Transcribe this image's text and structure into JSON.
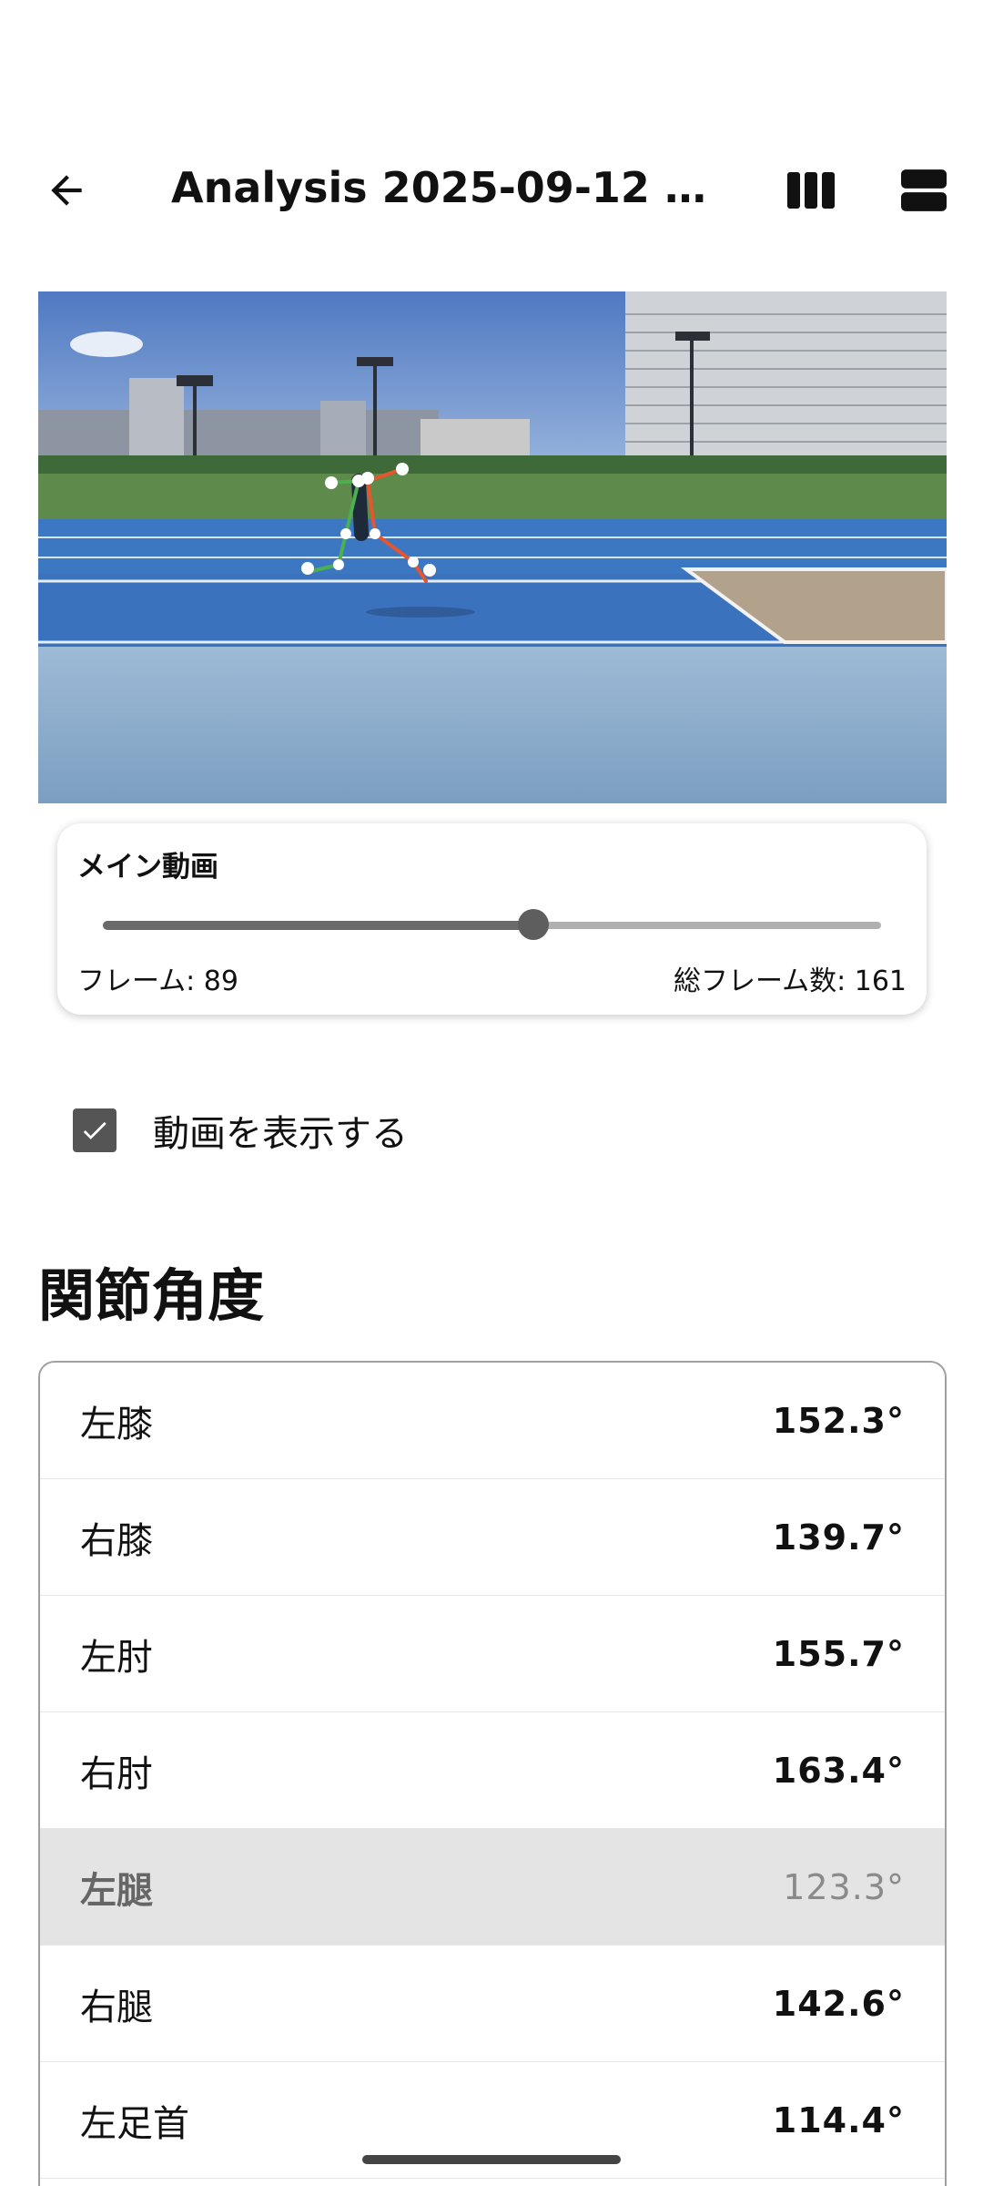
{
  "header": {
    "title": "Analysis 2025-09-12 21:1…",
    "back_icon": "arrow-left-icon",
    "layout_columns_icon": "view-columns-icon",
    "layout_rows_icon": "view-rows-icon"
  },
  "player": {
    "label": "メイン動画",
    "frame_label": "フレーム: 89",
    "total_label": "総フレーム数: 161",
    "current_frame": 89,
    "total_frames": 161
  },
  "show_video": {
    "label": "動画を表示する",
    "checked": true
  },
  "angles": {
    "title": "関節角度",
    "rows": [
      {
        "joint": "左膝",
        "value": "152.3°"
      },
      {
        "joint": "右膝",
        "value": "139.7°"
      },
      {
        "joint": "左肘",
        "value": "155.7°"
      },
      {
        "joint": "右肘",
        "value": "163.4°"
      },
      {
        "joint": "左腿",
        "value": "123.3°",
        "selected": true
      },
      {
        "joint": "右腿",
        "value": "142.6°"
      },
      {
        "joint": "左足首",
        "value": "114.4°"
      }
    ]
  }
}
